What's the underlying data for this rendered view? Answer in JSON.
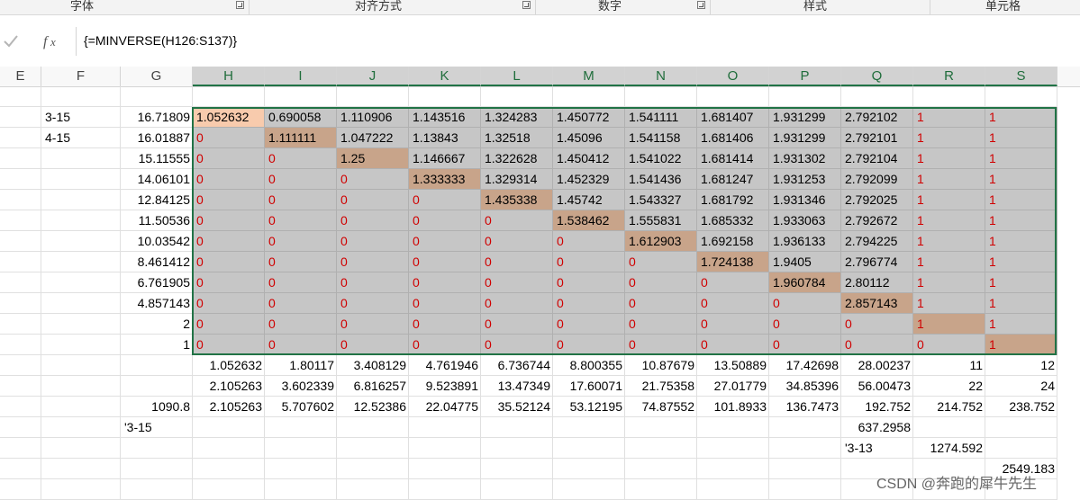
{
  "ribbon": {
    "groups": [
      {
        "label": "字体"
      },
      {
        "label": "对齐方式"
      },
      {
        "label": "数字"
      },
      {
        "label": "样式"
      },
      {
        "label": "单元格"
      }
    ]
  },
  "formula_bar": {
    "confirm_icon": "check-icon",
    "function_icon": "fx-icon",
    "formula": "{=MINVERSE(H126:S137)}"
  },
  "columns": [
    "E",
    "F",
    "G",
    "H",
    "I",
    "J",
    "K",
    "L",
    "M",
    "N",
    "O",
    "P",
    "Q",
    "R",
    "S"
  ],
  "selected_columns": [
    "H",
    "I",
    "J",
    "K",
    "L",
    "M",
    "N",
    "O",
    "P",
    "Q",
    "R",
    "S"
  ],
  "f_labels": [
    "3-15",
    "4-15"
  ],
  "g_values": [
    "16.71809",
    "16.01887",
    "15.11555",
    "14.06101",
    "12.84125",
    "11.50536",
    "10.03542",
    "8.461412",
    "6.761905",
    "4.857143",
    "2",
    "1"
  ],
  "matrix": [
    [
      "1.052632",
      "0.690058",
      "1.110906",
      "1.143516",
      "1.324283",
      "1.450772",
      "1.541111",
      "1.681407",
      "1.931299",
      "2.792102",
      "1",
      "1"
    ],
    [
      "0",
      "1.111111",
      "1.047222",
      "1.13843",
      "1.32518",
      "1.45096",
      "1.541158",
      "1.681406",
      "1.931299",
      "2.792101",
      "1",
      "1"
    ],
    [
      "0",
      "0",
      "1.25",
      "1.146667",
      "1.322628",
      "1.450412",
      "1.541022",
      "1.681414",
      "1.931302",
      "2.792104",
      "1",
      "1"
    ],
    [
      "0",
      "0",
      "0",
      "1.333333",
      "1.329314",
      "1.452329",
      "1.541436",
      "1.681247",
      "1.931253",
      "2.792099",
      "1",
      "1"
    ],
    [
      "0",
      "0",
      "0",
      "0",
      "1.435338",
      "1.45742",
      "1.543327",
      "1.681792",
      "1.931346",
      "2.792025",
      "1",
      "1"
    ],
    [
      "0",
      "0",
      "0",
      "0",
      "0",
      "1.538462",
      "1.555831",
      "1.685332",
      "1.933063",
      "2.792672",
      "1",
      "1"
    ],
    [
      "0",
      "0",
      "0",
      "0",
      "0",
      "0",
      "1.612903",
      "1.692158",
      "1.936133",
      "2.794225",
      "1",
      "1"
    ],
    [
      "0",
      "0",
      "0",
      "0",
      "0",
      "0",
      "0",
      "1.724138",
      "1.9405",
      "2.796774",
      "1",
      "1"
    ],
    [
      "0",
      "0",
      "0",
      "0",
      "0",
      "0",
      "0",
      "0",
      "1.960784",
      "2.80112",
      "1",
      "1"
    ],
    [
      "0",
      "0",
      "0",
      "0",
      "0",
      "0",
      "0",
      "0",
      "0",
      "2.857143",
      "1",
      "1"
    ],
    [
      "0",
      "0",
      "0",
      "0",
      "0",
      "0",
      "0",
      "0",
      "0",
      "0",
      "1",
      "1"
    ],
    [
      "0",
      "0",
      "0",
      "0",
      "0",
      "0",
      "0",
      "0",
      "0",
      "0",
      "0",
      "1"
    ]
  ],
  "below_rows": [
    {
      "g": "",
      "values": [
        "1.052632",
        "1.80117",
        "3.408129",
        "4.761946",
        "6.736744",
        "8.800355",
        "10.87679",
        "13.50889",
        "17.42698",
        "28.00237",
        "11",
        "12"
      ]
    },
    {
      "g": "",
      "values": [
        "2.105263",
        "3.602339",
        "6.816257",
        "9.523891",
        "13.47349",
        "17.60071",
        "21.75358",
        "27.01779",
        "34.85396",
        "56.00473",
        "22",
        "24"
      ]
    },
    {
      "g": "1090.8",
      "values": [
        "2.105263",
        "5.707602",
        "12.52386",
        "22.04775",
        "35.52124",
        "53.12195",
        "74.87552",
        "101.8933",
        "136.7473",
        "192.752",
        "214.752",
        "238.752"
      ]
    }
  ],
  "extra": {
    "g_label": "'3-15",
    "q_value": "637.2958",
    "q_label": "'3-13",
    "r_value": "1274.592",
    "s_value": "2549.183"
  },
  "watermark": "CSDN @奔跑的犀牛先生",
  "colors": {
    "selection": "#217346",
    "matrix_fill": "#c6c6c6",
    "diagonal_fill": "#c8a48a",
    "first_cell_fill": "#f8cbad",
    "red_text": "#d00000"
  }
}
